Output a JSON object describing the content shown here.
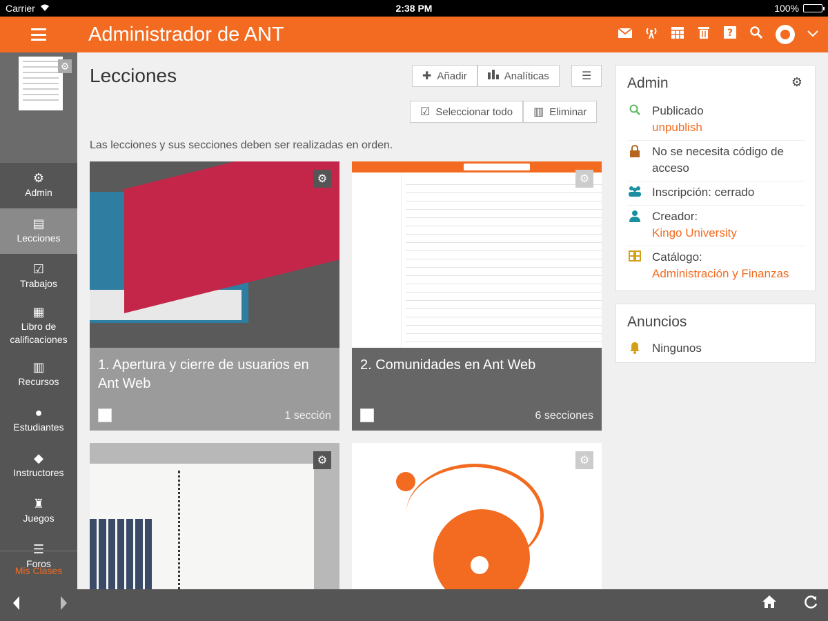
{
  "statusbar": {
    "carrier": "Carrier",
    "time": "2:38 PM",
    "battery": "100%"
  },
  "header": {
    "title": "Administrador de ANT",
    "icons": [
      "mail-icon",
      "broadcast-icon",
      "calendar-icon",
      "trash-icon",
      "help-icon",
      "search-icon",
      "avatar",
      "chevron-down-icon"
    ],
    "accent": "#f26b21"
  },
  "sidebar": {
    "items": [
      {
        "label": "Admin",
        "icon": "gear-icon"
      },
      {
        "label": "Lecciones",
        "icon": "book-icon",
        "active": true
      },
      {
        "label": "Trabajos",
        "icon": "checkbox-icon"
      },
      {
        "label": "Libro de calificaciones",
        "icon": "gradebook-icon"
      },
      {
        "label": "Recursos",
        "icon": "resources-icon"
      },
      {
        "label": "Estudiantes",
        "icon": "person-icon"
      },
      {
        "label": "Instructores",
        "icon": "instructor-icon"
      },
      {
        "label": "Juegos",
        "icon": "trophy-icon"
      },
      {
        "label": "Foros",
        "icon": "list-icon"
      }
    ],
    "footer": "Mis Clases"
  },
  "main": {
    "title": "Lecciones",
    "buttons": {
      "add": "Añadir",
      "analytics": "Analíticas",
      "select_all": "Seleccionar todo",
      "delete": "Eliminar"
    },
    "instructions": "Las lecciones y sus secciones deben ser realizadas en orden.",
    "lessons": [
      {
        "title": "1. Apertura y cierre de usuarios en Ant Web",
        "count": "1 sección"
      },
      {
        "title": "2. Comunidades en Ant Web",
        "count": "6 secciones"
      }
    ]
  },
  "admin_panel": {
    "title": "Admin",
    "rows": [
      {
        "text": "Publicado",
        "link": "unpublish",
        "icon": "search-icon",
        "color": "#5cb85c"
      },
      {
        "text": "No se necesita código de acceso",
        "icon": "lock-icon",
        "color": "#b5651d"
      },
      {
        "text": "Inscripción: cerrado",
        "icon": "group-icon",
        "color": "#1a8fa0"
      },
      {
        "text": "Creador:",
        "link": "Kingo University",
        "icon": "person-icon",
        "color": "#1a8fa0"
      },
      {
        "text": "Catálogo:",
        "link": "Administración y Finanzas",
        "icon": "catalog-icon",
        "color": "#d4a017"
      }
    ]
  },
  "announcements": {
    "title": "Anuncios",
    "empty": "Ningunos",
    "icon": "bell-icon"
  }
}
